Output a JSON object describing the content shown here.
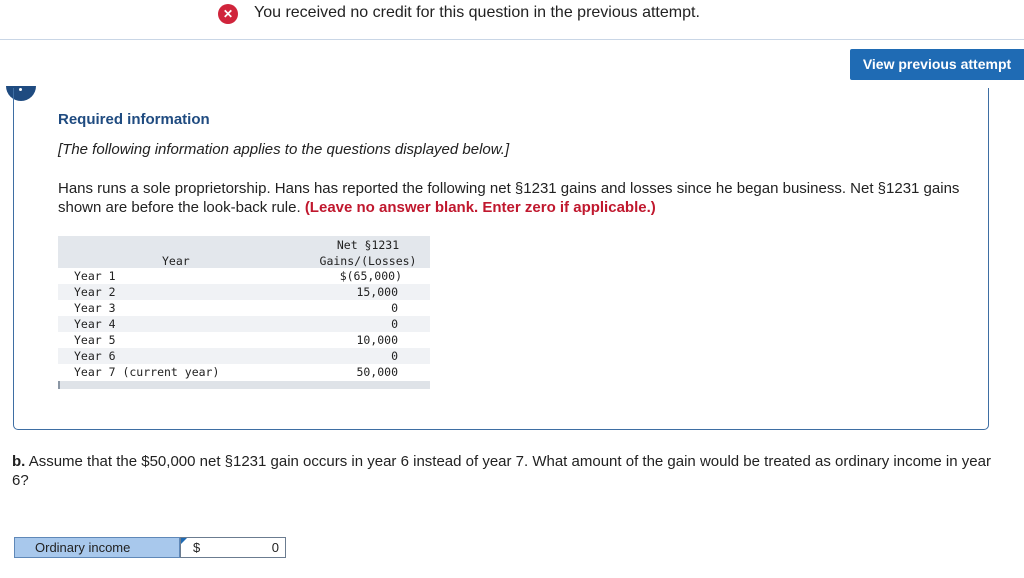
{
  "banner": {
    "icon": "x-circle-icon",
    "text": "You received no credit for this question in the previous attempt."
  },
  "view_button": {
    "label": "View previous attempt"
  },
  "required": {
    "title": "Required information",
    "subtitle": "[The following information applies to the questions displayed below.]",
    "intro": "Hans runs a sole proprietorship. Hans has reported the following net §1231 gains and losses since he began business. Net §1231 gains shown are before the look-back rule.",
    "instruction": "(Leave no answer blank. Enter zero if applicable.)"
  },
  "table": {
    "col_year": "Year",
    "col_gains_1": "Net §1231",
    "col_gains_2": "Gains/(Losses)",
    "rows": [
      {
        "year": "Year 1",
        "value": "$(65,000)"
      },
      {
        "year": "Year 2",
        "value": "15,000"
      },
      {
        "year": "Year 3",
        "value": "0"
      },
      {
        "year": "Year 4",
        "value": "0"
      },
      {
        "year": "Year 5",
        "value": "10,000"
      },
      {
        "year": "Year 6",
        "value": "0"
      },
      {
        "year": "Year 7 (current year)",
        "value": "50,000"
      }
    ]
  },
  "question": {
    "letter": "b.",
    "text": "Assume that the $50,000 net §1231 gain occurs in year 6 instead of year 7. What amount of the gain would be treated as ordinary income in year 6?"
  },
  "answer": {
    "label": "Ordinary income",
    "currency": "$",
    "value": "0"
  },
  "colors": {
    "accent": "#1f6bb4",
    "error": "#d0243b",
    "instruction_red": "#c0182e"
  }
}
